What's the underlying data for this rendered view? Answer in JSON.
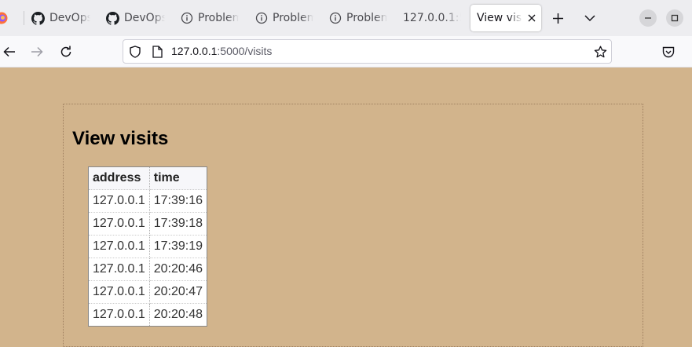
{
  "browser": {
    "tabs": [
      {
        "label": "DevOps",
        "icon": "github-icon"
      },
      {
        "label": "DevOps",
        "icon": "github-icon"
      },
      {
        "label": "Problem",
        "icon": "info-icon"
      },
      {
        "label": "Problem",
        "icon": "info-icon"
      },
      {
        "label": "Problem",
        "icon": "info-icon"
      },
      {
        "label": "127.0.0.1:5",
        "icon": ""
      },
      {
        "label": "View visits",
        "icon": "",
        "active": true
      }
    ],
    "url_host": "127.0.0.1",
    "url_path": ":5000/visits"
  },
  "page": {
    "title": "View visits",
    "table": {
      "headers": [
        "address",
        "time"
      ],
      "rows": [
        [
          "127.0.0.1",
          "17:39:16"
        ],
        [
          "127.0.0.1",
          "17:39:18"
        ],
        [
          "127.0.0.1",
          "17:39:19"
        ],
        [
          "127.0.0.1",
          "20:20:46"
        ],
        [
          "127.0.0.1",
          "20:20:47"
        ],
        [
          "127.0.0.1",
          "20:20:48"
        ]
      ]
    }
  },
  "colors": {
    "page_background": "#d2b48c",
    "tabbar_background": "#ededf0"
  }
}
